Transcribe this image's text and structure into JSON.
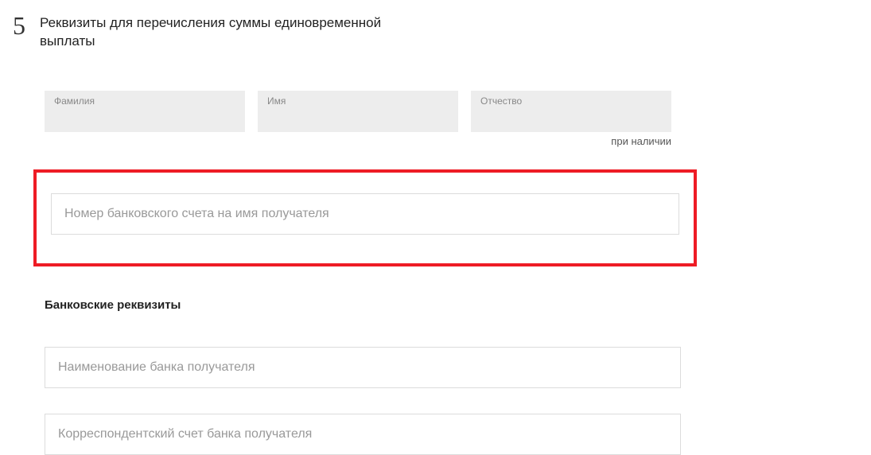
{
  "section": {
    "number": "5",
    "title": "Реквизиты для перечисления суммы единовременной выплаты"
  },
  "name_fields": {
    "surname_label": "Фамилия",
    "name_label": "Имя",
    "patronymic_label": "Отчество",
    "patronymic_hint": "при наличии"
  },
  "account": {
    "placeholder": "Номер банковского счета на имя получателя"
  },
  "bank": {
    "section_title": "Банковские реквизиты",
    "name_placeholder": "Наименование банка получателя",
    "corr_placeholder": "Корреспондентский счет банка получателя"
  }
}
